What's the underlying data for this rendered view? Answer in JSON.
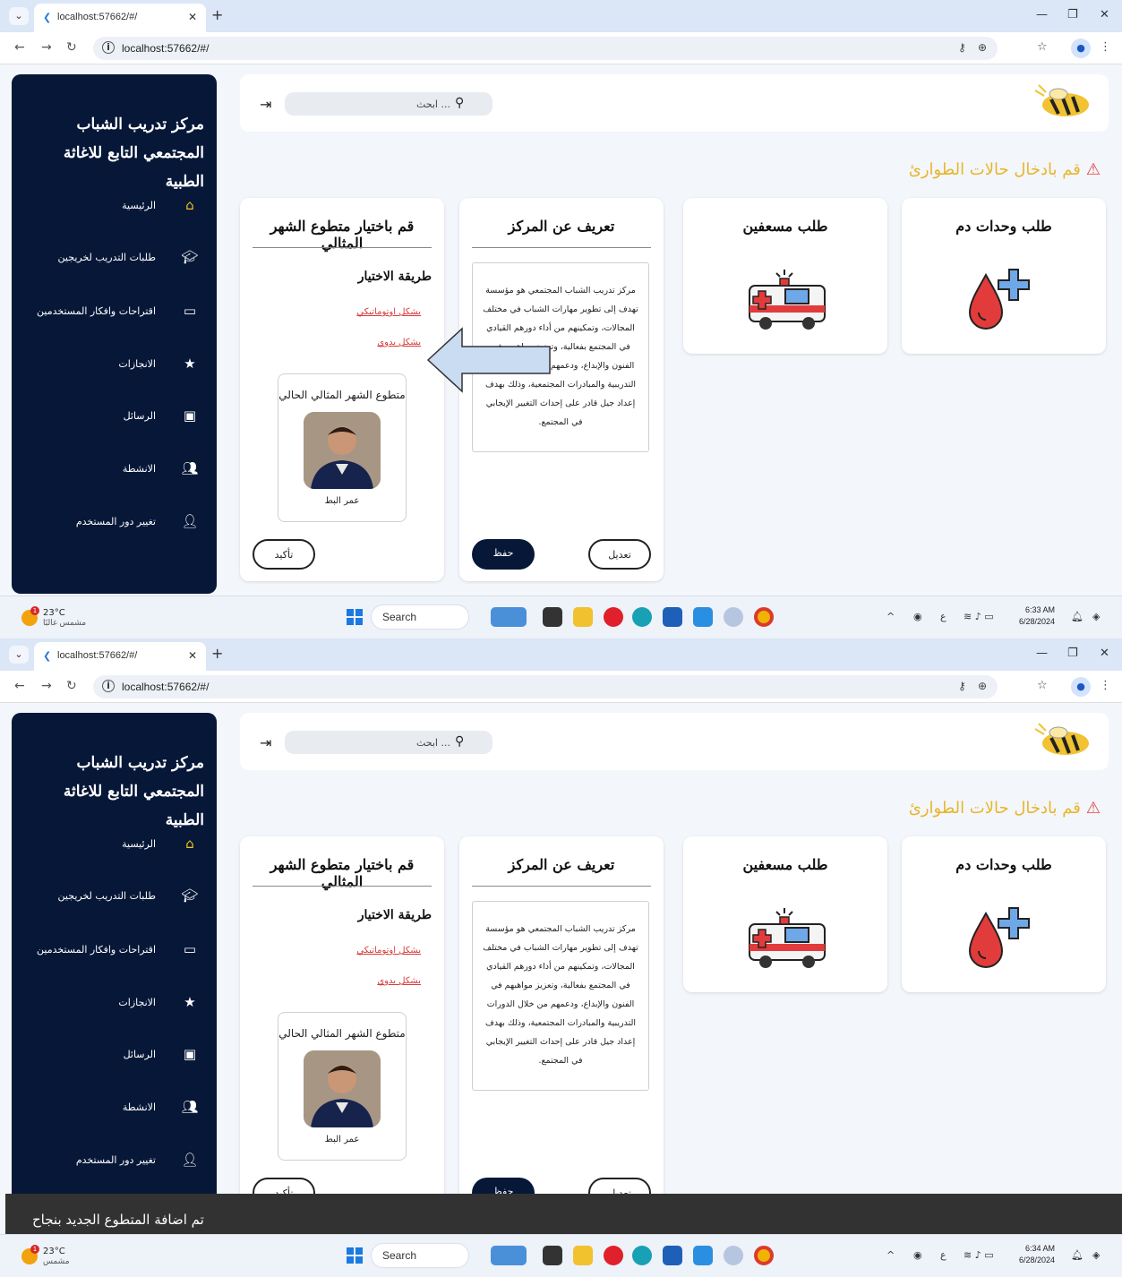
{
  "browser": {
    "tab_title": "localhost:57662/#/",
    "url": "localhost:57662/#/",
    "new_tab": "+",
    "profile_initial": "●"
  },
  "app": {
    "sidebar_title": "مركز تدريب الشباب المجتمعي التابع للاغاثة الطبية",
    "nav": [
      {
        "label": "الرئيسية",
        "icon": "home-icon"
      },
      {
        "label": "طلبات التدريب لخريجين",
        "icon": "graduation-cap-icon"
      },
      {
        "label": "اقتراحات وافكار المستخدمين",
        "icon": "comment-icon"
      },
      {
        "label": "الانجازات",
        "icon": "star-icon"
      },
      {
        "label": "الرسائل",
        "icon": "id-card-icon"
      },
      {
        "label": "الانشطة",
        "icon": "group-add-icon"
      },
      {
        "label": "تغيير دور المستخدم",
        "icon": "person-add-icon"
      }
    ],
    "search_placeholder": "ابحث ...",
    "emergency_heading": "قم بادخال حالات الطوارئ",
    "cards": {
      "blood": {
        "title": "طلب وحدات دم",
        "icon": "blood-drop-plus-icon"
      },
      "ambulance": {
        "title": "طلب مسعفين",
        "icon": "ambulance-icon"
      },
      "about": {
        "title": "تعريف عن المركز",
        "text": "مركز تدريب الشباب المجتمعي هو مؤسسة تهدف إلى تطوير مهارات الشباب في مختلف المجالات، وتمكينهم من أداء دورهم القيادي في المجتمع بفعالية، وتعزيز مواهبهم في الفنون والإبداع، ودعمهم من خلال الدورات التدريبية والمبادرات المجتمعية، وذلك بهدف إعداد جيل قادر على إحداث التغيير الإيجابي في المجتمع.",
        "edit_label": "تعديل",
        "save_label": "حفظ"
      },
      "volunteer": {
        "title": "قم باختيار متطوع الشهر المثالي",
        "method_label": "طريقة الاختيار",
        "option_auto": "بشكل اوتوماتيكي",
        "option_manual": "بشكل يدوي",
        "current_title": "متطوع الشهر المثالي الحالي",
        "current_name": "عمر البط",
        "confirm_label": "تأكيد"
      }
    },
    "toast": "تم اضافة المتطوع الجديد بنجاح"
  },
  "taskbar": {
    "weather_temp": "23°C",
    "weather_cond_1": "مشمس غالبًا",
    "weather_cond_2": "مشمس",
    "weather_badge": "1",
    "search_label": "Search",
    "lang": "ع",
    "time_1": "6:33 AM",
    "time_2": "6:34 AM",
    "date": "6/28/2024"
  },
  "colors": {
    "sidebar_bg": "#061738",
    "accent_yellow": "#e8b52b",
    "alert_red": "#d83a3a",
    "arrow_fill": "#c9dcf2"
  }
}
